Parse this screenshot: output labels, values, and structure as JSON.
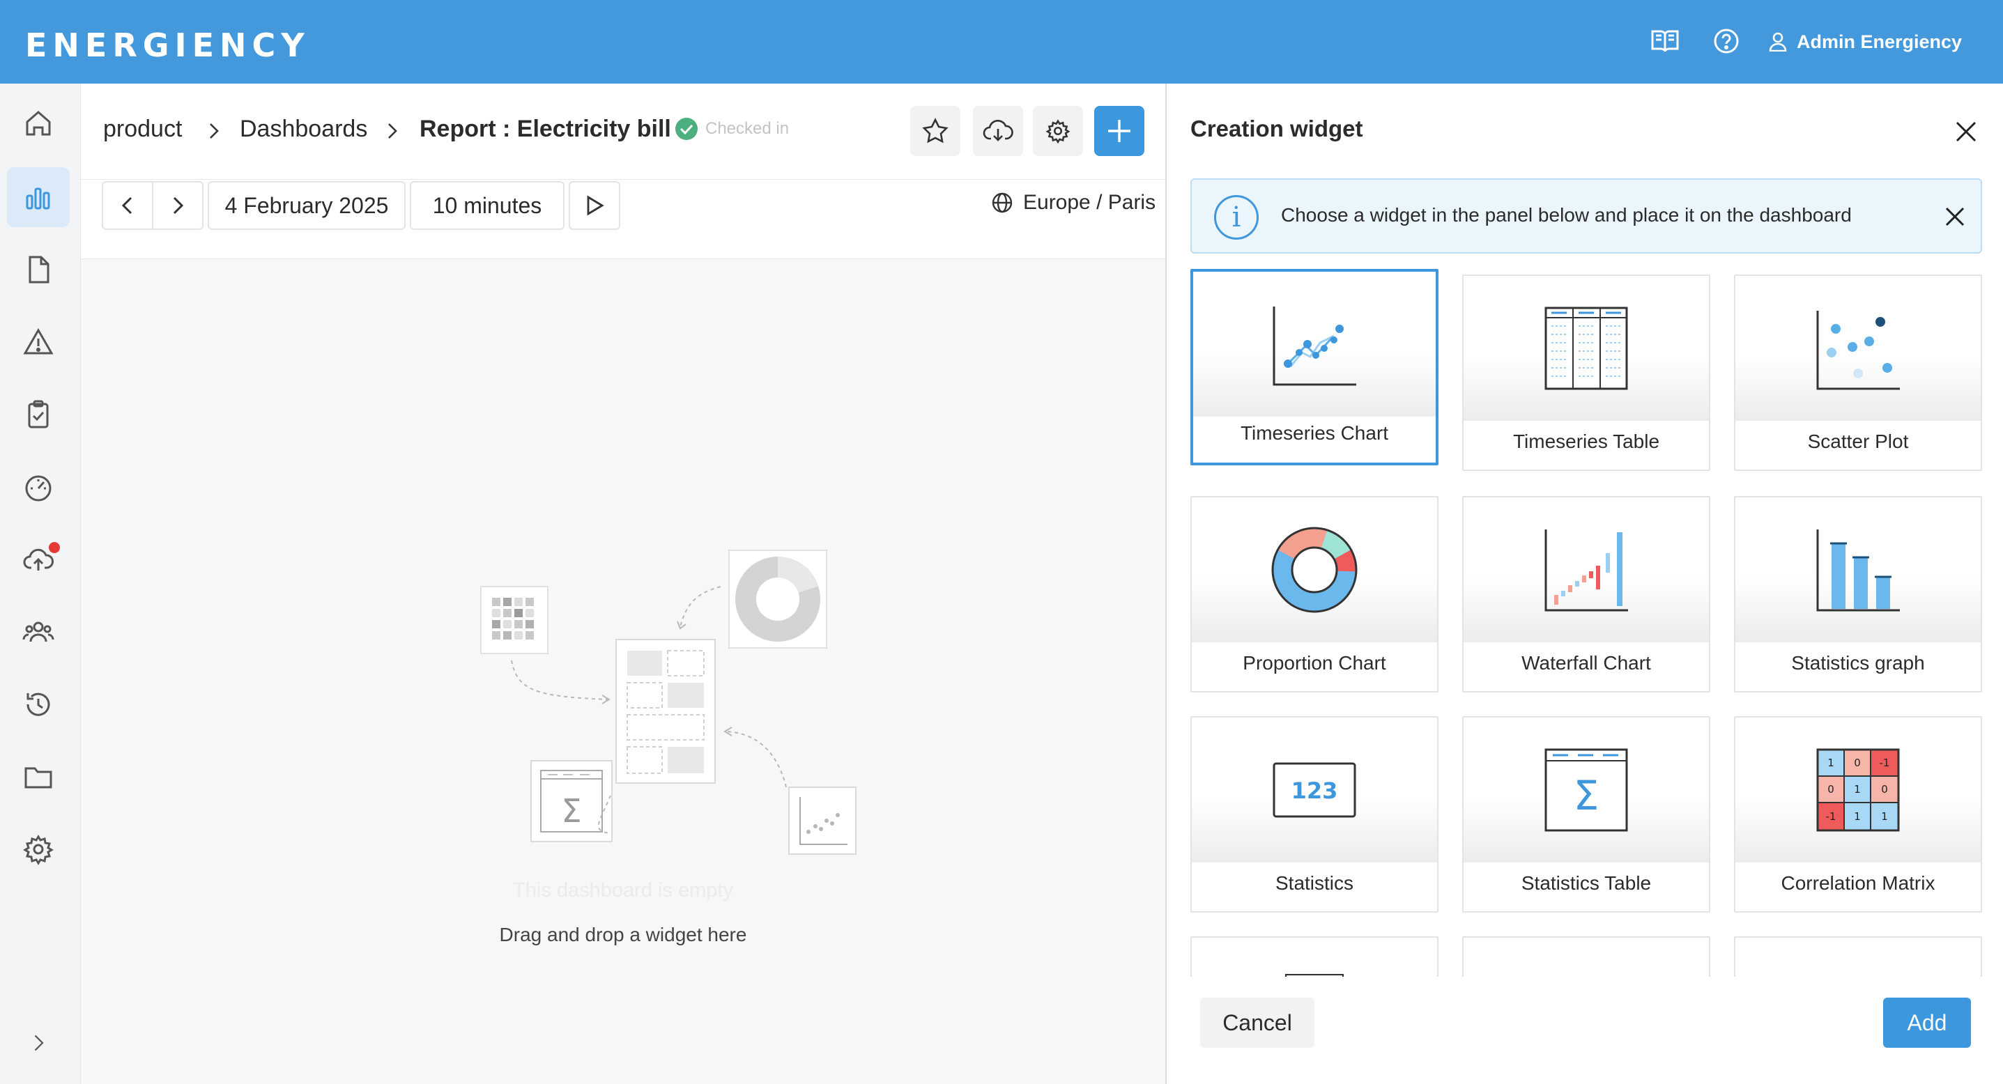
{
  "app": {
    "logo_text": "ENERGIENCY",
    "user_name": "Admin Energiency"
  },
  "breadcrumb": {
    "items": [
      "product",
      "Dashboards"
    ],
    "current": "Report : Electricity bill",
    "status": "Checked in"
  },
  "toolbar": {
    "date": "4 February 2025",
    "interval": "10 minutes",
    "timezone": "Europe / Paris"
  },
  "empty_state": {
    "title": "This dashboard is empty",
    "subtitle": "Drag and drop a widget here"
  },
  "panel": {
    "title": "Creation widget",
    "info": "Choose a widget in the panel below and place it on the dashboard",
    "widgets": [
      {
        "label": "Timeseries Chart",
        "selected": true
      },
      {
        "label": "Timeseries Table",
        "selected": false
      },
      {
        "label": "Scatter Plot",
        "selected": false
      },
      {
        "label": "Proportion Chart",
        "selected": false
      },
      {
        "label": "Waterfall Chart",
        "selected": false
      },
      {
        "label": "Statistics graph",
        "selected": false
      },
      {
        "label": "Statistics",
        "selected": false,
        "thumb_text": "123"
      },
      {
        "label": "Statistics Table",
        "selected": false
      },
      {
        "label": "Correlation Matrix",
        "selected": false,
        "matrix": [
          "1",
          "0",
          "-1",
          "0",
          "1",
          "0",
          "-1",
          "1",
          "1"
        ]
      }
    ],
    "cancel_label": "Cancel",
    "add_label": "Add"
  },
  "colors": {
    "brand": "#4399dc",
    "accent": "#3d97dd",
    "success": "#4caf7d",
    "alert": "#e53935"
  }
}
